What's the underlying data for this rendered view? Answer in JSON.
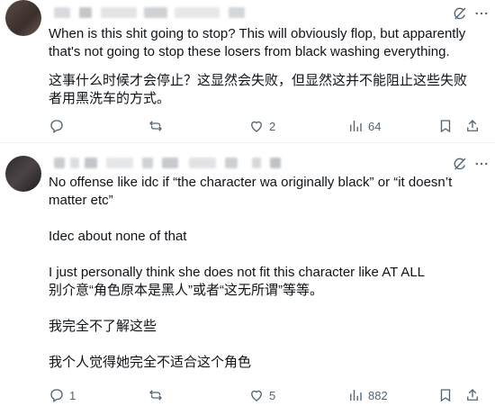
{
  "tweets": [
    {
      "text_en": "When is this shit going to stop? This will obviously flop, but apparently that's not going to stop these losers from black washing everything.",
      "text_zh": "这事什么时候才会停止？这显然会失败，但显然这并不能阻止这些失败者用黑洗车的方式。",
      "actions": {
        "reply_count": "",
        "retweet_count": "",
        "like_count": "2",
        "views_count": "64"
      }
    },
    {
      "paragraphs": [
        "No offense like idc if “the character wa originally black” or “it doesn’t matter etc”",
        "Idec about none of that",
        "I just personally think she does not fit this character like AT ALL",
        "别介意“角色原本是黑人”或者“这无所谓”等等。",
        "我完全不了解这些",
        "我个人觉得她完全不适合这个角色"
      ],
      "actions": {
        "reply_count": "1",
        "retweet_count": "",
        "like_count": "5",
        "views_count": "882"
      }
    }
  ],
  "icons": {
    "grok": "grok-icon",
    "more": "more-icon",
    "reply": "reply-icon",
    "retweet": "retweet-icon",
    "like": "heart-icon",
    "views": "views-icon",
    "share": "share-icon"
  },
  "colors": {
    "text": "#0f1419",
    "muted": "#536471",
    "divider": "#eff3f4"
  }
}
